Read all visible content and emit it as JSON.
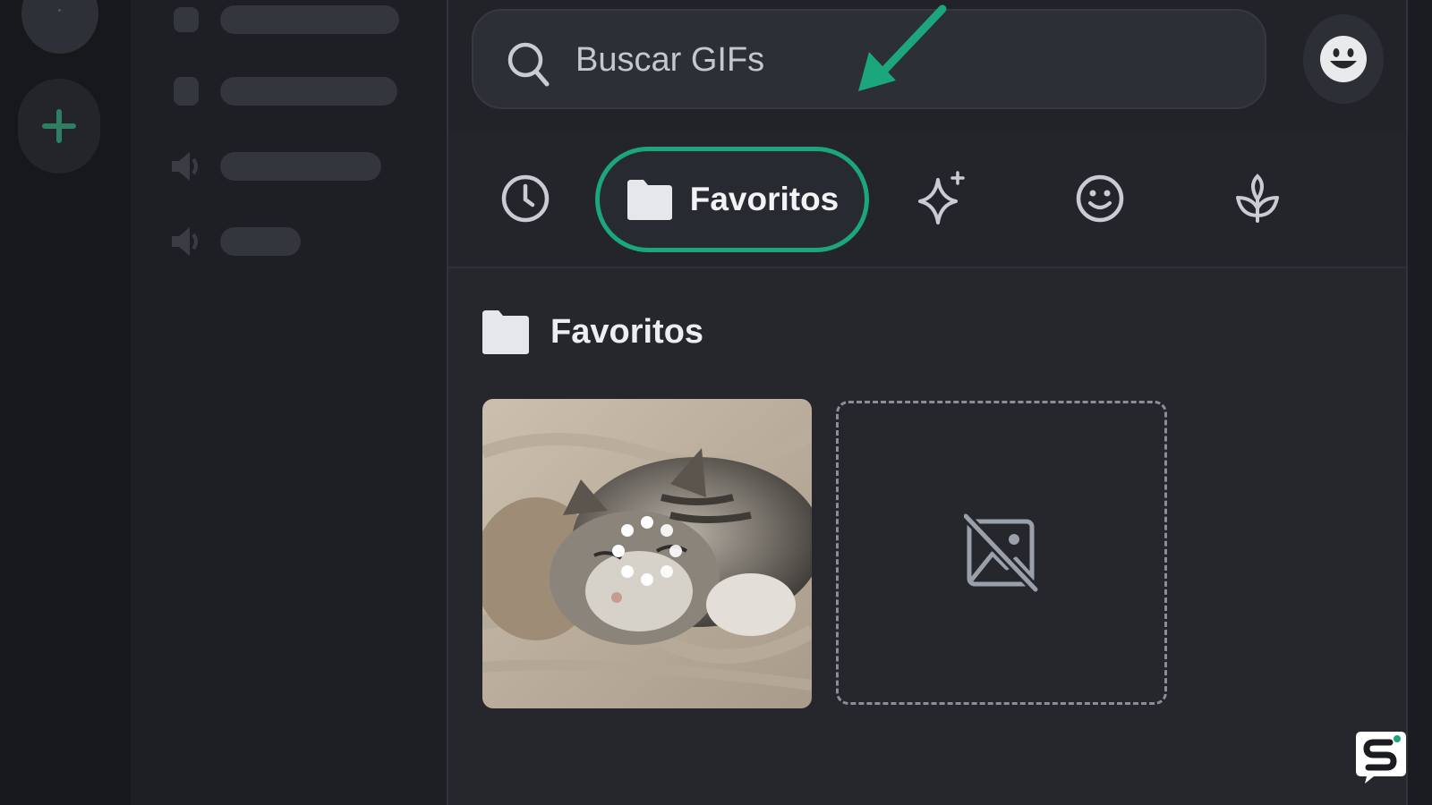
{
  "search": {
    "placeholder": "Buscar GIFs"
  },
  "tabs": [
    {
      "name": "recent",
      "icon": "clock-icon"
    },
    {
      "name": "favorites",
      "label": "Favoritos",
      "icon": "folder-icon",
      "selected": true
    },
    {
      "name": "trending",
      "icon": "sparkle-icon"
    },
    {
      "name": "reactions",
      "icon": "smiley-icon"
    },
    {
      "name": "nature",
      "icon": "sprout-icon"
    }
  ],
  "section": {
    "title": "Favoritos",
    "icon": "folder-icon"
  },
  "gifs": [
    {
      "kind": "image",
      "subject": "sleeping-cat",
      "state": "loading"
    },
    {
      "kind": "placeholder",
      "icon": "broken-image-icon"
    }
  ],
  "colors": {
    "accent": "#1ba67b",
    "background": "#1a1c21",
    "panel": "#25272d",
    "text": "#f2f3f5"
  }
}
